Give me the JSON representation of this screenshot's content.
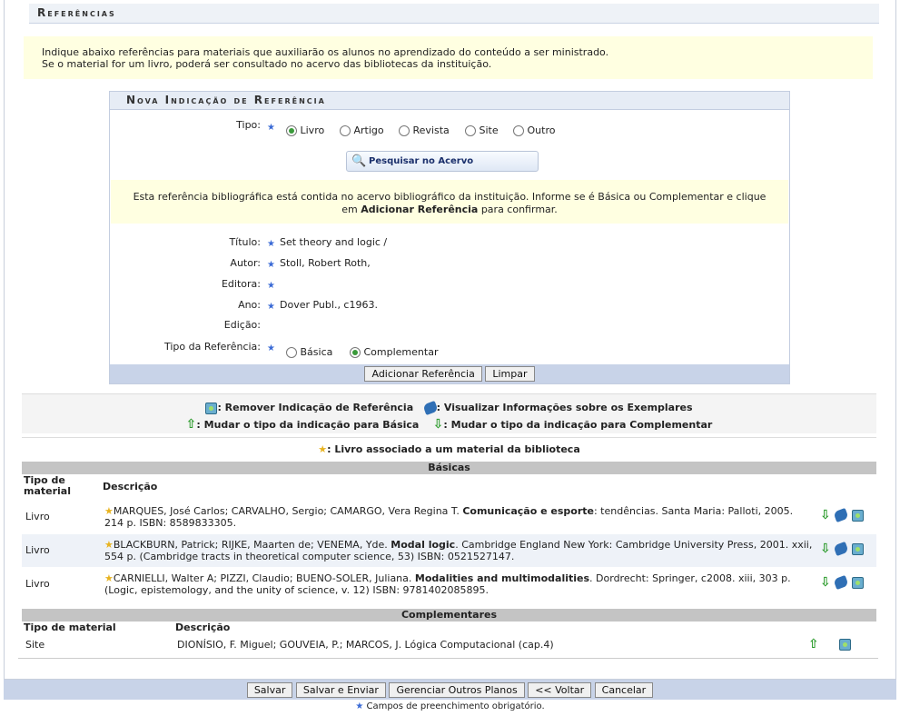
{
  "header": {
    "title": "Referências"
  },
  "intro": {
    "line1": "Indique abaixo referências para materiais que auxiliarão os alunos no aprendizado do conteúdo a ser ministrado.",
    "line2": "Se o material for um livro, poderá ser consultado no acervo das bibliotecas da instituição."
  },
  "form": {
    "title": "Nova Indicação de Referência",
    "tipo_label": "Tipo:",
    "tipo_options": [
      "Livro",
      "Artigo",
      "Revista",
      "Site",
      "Outro"
    ],
    "tipo_selected": "Livro",
    "search_button": "Pesquisar no Acervo",
    "notice_part1": "Esta referência bibliográfica está contida no acervo bibliográfico da instituição. Informe se é Básica ou Complementar e clique em ",
    "notice_bold": "Adicionar Referência",
    "notice_part2": " para confirmar.",
    "titulo_label": "Título:",
    "titulo_value": "Set theory and logic /",
    "autor_label": "Autor:",
    "autor_value": "Stoll, Robert Roth,",
    "editora_label": "Editora:",
    "editora_value": "",
    "ano_label": "Ano:",
    "ano_value": "Dover Publ., c1963.",
    "edicao_label": "Edição:",
    "tiporef_label": "Tipo da Referência:",
    "tiporef_options": [
      "Básica",
      "Complementar"
    ],
    "tiporef_selected": "Complementar",
    "add_button": "Adicionar Referência",
    "clear_button": "Limpar"
  },
  "legend": {
    "remove": ": Remover Indicação de Referência",
    "view": ": Visualizar Informações sobre os Exemplares",
    "to_basica": ": Mudar o tipo da indicação para Básica",
    "to_complementar": ": Mudar o tipo da indicação para Complementar",
    "star": ": Livro associado a um material da biblioteca"
  },
  "basicas": {
    "section_title": "Básicas",
    "col_tipo": "Tipo de material",
    "col_desc": "Descrição",
    "rows": [
      {
        "tipo": "Livro",
        "pre": "MARQUES, José Carlos; CARVALHO, Sergio; CAMARGO, Vera Regina T. ",
        "bold": "Comunicação e esporte",
        "post": ": tendências. Santa Maria: Palloti, 2005. 214 p. ISBN: 8589833305."
      },
      {
        "tipo": "Livro",
        "pre": "BLACKBURN, Patrick; RIJKE, Maarten de; VENEMA, Yde. ",
        "bold": "Modal logic",
        "post": ". Cambridge England New York: Cambridge University Press, 2001. xxii, 554 p. (Cambridge tracts in theoretical computer science, 53) ISBN: 0521527147."
      },
      {
        "tipo": "Livro",
        "pre": "CARNIELLI, Walter A; PIZZI, Claudio; BUENO-SOLER, Juliana. ",
        "bold": "Modalities and multimodalities",
        "post": ". Dordrecht: Springer, c2008. xiii, 303 p. (Logic, epistemology, and the unity of science, v. 12) ISBN: 9781402085895."
      }
    ]
  },
  "complementares": {
    "section_title": "Complementares",
    "col_tipo": "Tipo de material",
    "col_desc": "Descrição",
    "rows": [
      {
        "tipo": "Site",
        "desc": "DIONÍSIO, F. Miguel; GOUVEIA, P.; MARCOS, J. Lógica Computacional (cap.4)"
      }
    ]
  },
  "bottom": {
    "buttons": [
      "Salvar",
      "Salvar e Enviar",
      "Gerenciar Outros Planos",
      "<< Voltar",
      "Cancelar"
    ],
    "required_note": "Campos de preenchimento obrigatório."
  },
  "colors": {
    "accent_blue": "#3b6bd6",
    "notice_yellow": "#ffffe1",
    "bar_blue": "#c8d3e8",
    "section_gray": "#c4c4c4"
  },
  "icons": [
    "search-icon",
    "trash-icon",
    "binoculars-icon",
    "arrow-up-icon",
    "arrow-down-icon",
    "star-icon",
    "required-star-icon"
  ]
}
